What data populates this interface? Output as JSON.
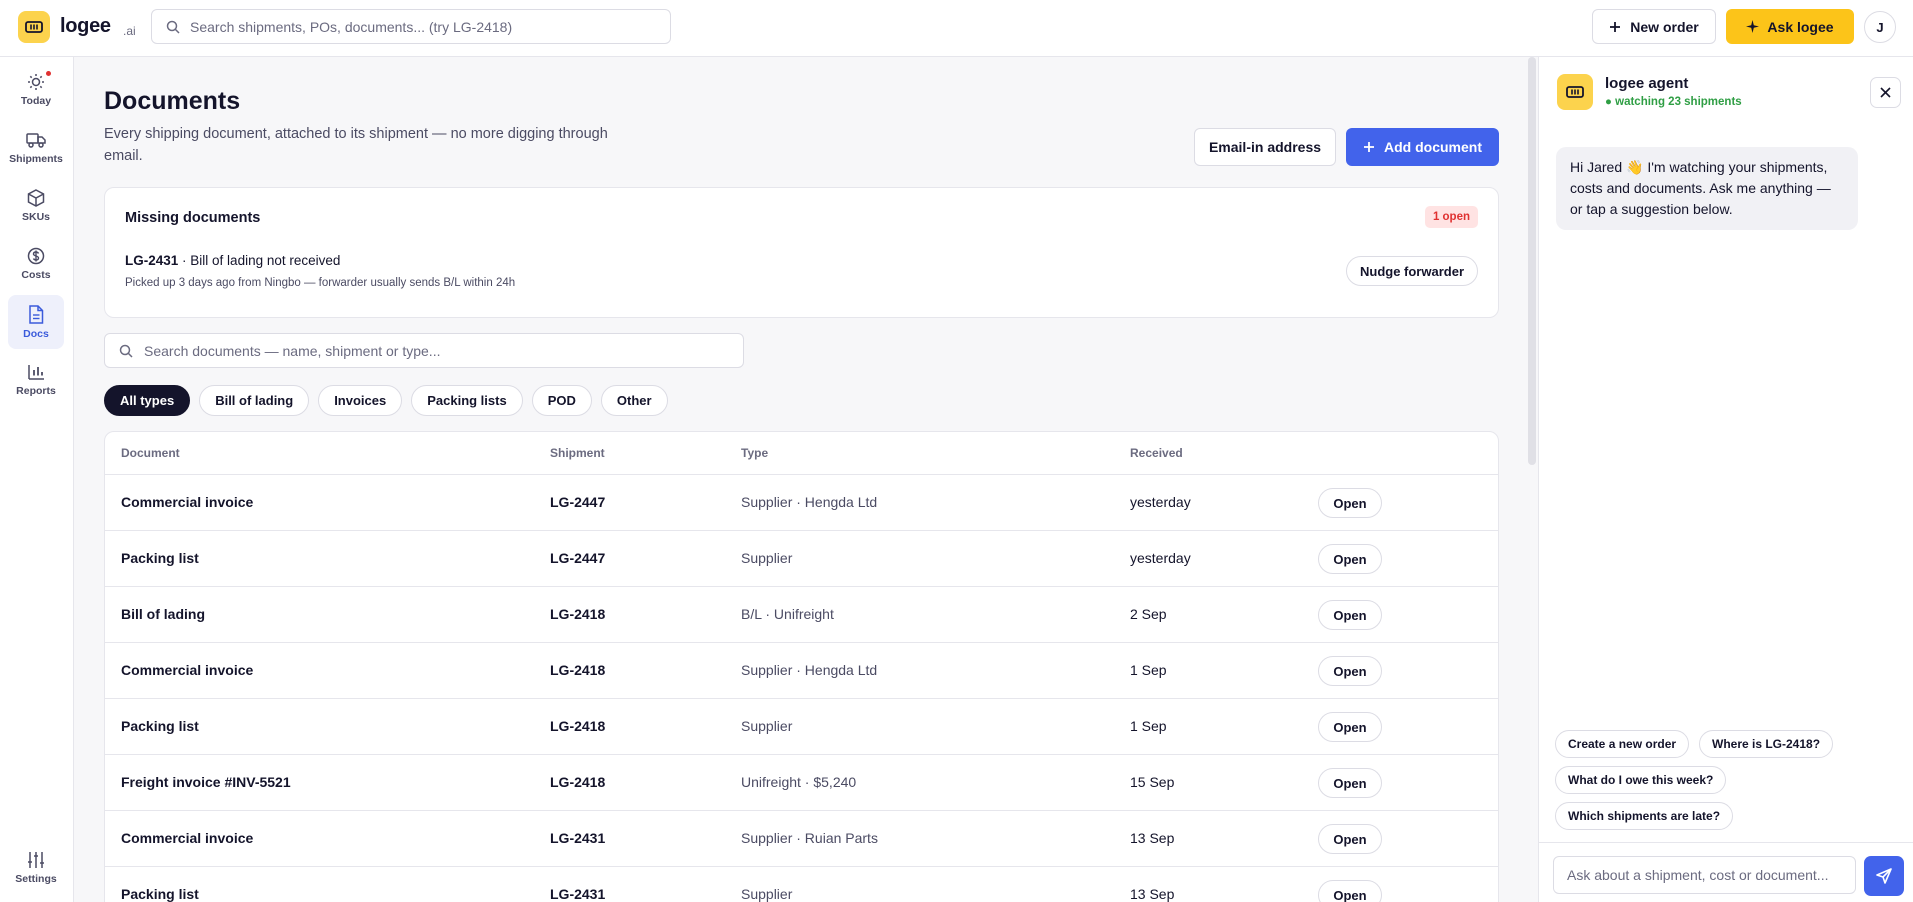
{
  "app": {
    "brand": "logee",
    "brand_suffix": ".ai"
  },
  "topbar": {
    "search_placeholder": "Search shipments, POs, documents... (try LG-2418)",
    "new_order_label": "New order",
    "ask_label": "Ask logee",
    "avatar_initial": "J"
  },
  "sidebar": {
    "items": [
      {
        "label": "Today",
        "icon": "sun-icon"
      },
      {
        "label": "Shipments",
        "icon": "truck-icon"
      },
      {
        "label": "SKUs",
        "icon": "box-icon"
      },
      {
        "label": "Costs",
        "icon": "dollar-icon"
      },
      {
        "label": "Docs",
        "icon": "document-icon",
        "active": true
      },
      {
        "label": "Reports",
        "icon": "bar-chart-icon"
      }
    ],
    "settings_label": "Settings"
  },
  "page": {
    "title": "Documents",
    "subtitle": "Every shipping document, attached to its shipment — no more digging through email.",
    "email_in_label": "Email-in address",
    "add_document_label": "Add document"
  },
  "missing": {
    "title": "Missing documents",
    "badge": "1 open",
    "shipment": "LG-2431",
    "issue": "· Bill of lading not received",
    "detail": "Picked up 3 days ago from Ningbo — forwarder usually sends B/L within 24h",
    "action_label": "Nudge forwarder"
  },
  "doc_search_placeholder": "Search documents — name, shipment or type...",
  "filters": [
    "All types",
    "Bill of lading",
    "Invoices",
    "Packing lists",
    "POD",
    "Other"
  ],
  "table": {
    "headers": [
      "Document",
      "Shipment",
      "Type",
      "Received"
    ],
    "open_label": "Open",
    "rows": [
      {
        "document": "Commercial invoice",
        "shipment": "LG-2447",
        "type": "Supplier · Hengda Ltd",
        "received": "yesterday"
      },
      {
        "document": "Packing list",
        "shipment": "LG-2447",
        "type": "Supplier",
        "received": "yesterday"
      },
      {
        "document": "Bill of lading",
        "shipment": "LG-2418",
        "type": "B/L · Unifreight",
        "received": "2 Sep"
      },
      {
        "document": "Commercial invoice",
        "shipment": "LG-2418",
        "type": "Supplier · Hengda Ltd",
        "received": "1 Sep"
      },
      {
        "document": "Packing list",
        "shipment": "LG-2418",
        "type": "Supplier",
        "received": "1 Sep"
      },
      {
        "document": "Freight invoice #INV-5521",
        "shipment": "LG-2418",
        "type": "Unifreight · $5,240",
        "received": "15 Sep"
      },
      {
        "document": "Commercial invoice",
        "shipment": "LG-2431",
        "type": "Supplier · Ruian Parts",
        "received": "13 Sep"
      },
      {
        "document": "Packing list",
        "shipment": "LG-2431",
        "type": "Supplier",
        "received": "13 Sep"
      }
    ]
  },
  "agent": {
    "title": "logee agent",
    "status": "● watching 23 shipments",
    "greeting": "Hi Jared 👋 I'm watching your shipments, costs and documents. Ask me anything — or tap a suggestion below.",
    "suggestions": [
      "Create a new order",
      "Where is LG-2418?",
      "What do I owe this week?",
      "Which shipments are late?"
    ],
    "input_placeholder": "Ask about a shipment, cost or document..."
  },
  "colors": {
    "accent": "#4263eb",
    "brand": "#fcc419",
    "danger": "#e03131",
    "success": "#2f9e44"
  }
}
